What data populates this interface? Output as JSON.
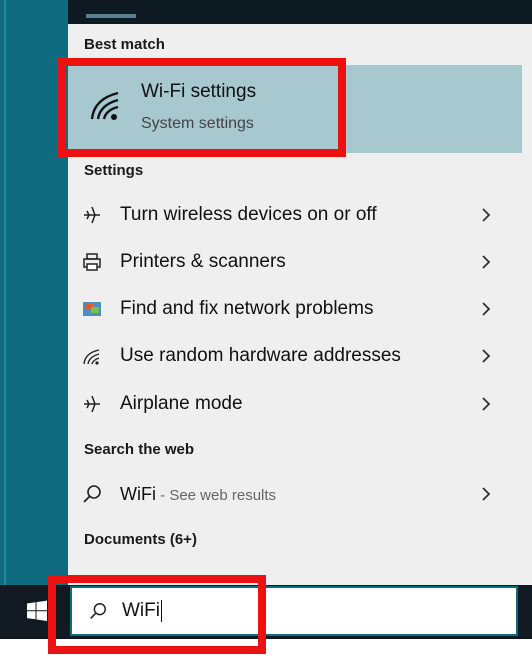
{
  "headers": {
    "best_match": "Best match",
    "settings": "Settings",
    "search_web": "Search the web",
    "documents": "Documents (6+)"
  },
  "best_match": {
    "title": "Wi-Fi settings",
    "subtitle": "System settings",
    "icon": "wifi-icon"
  },
  "settings_items": [
    {
      "label": "Turn wireless devices on or off",
      "icon": "airplane-icon"
    },
    {
      "label": "Printers & scanners",
      "icon": "printer-icon"
    },
    {
      "label": "Find and fix network problems",
      "icon": "troubleshoot-icon"
    },
    {
      "label": "Use random hardware addresses",
      "icon": "wifi-small-icon"
    },
    {
      "label": "Airplane mode",
      "icon": "airplane-icon"
    }
  ],
  "web_result": {
    "query": "WiFi",
    "suffix": " - See web results",
    "icon": "search-icon"
  },
  "search": {
    "value": "WiFi",
    "icon": "search-icon"
  },
  "colors": {
    "accent": "#0f6b80",
    "selection": "#a8c8cf",
    "highlight_box": "#ee1111"
  }
}
